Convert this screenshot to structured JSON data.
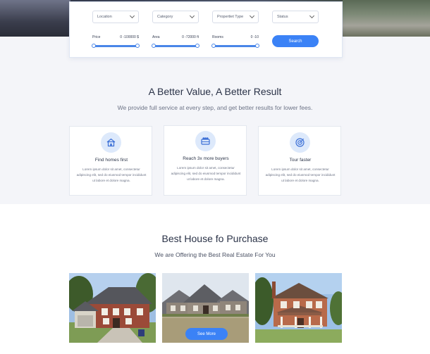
{
  "search": {
    "selects": [
      {
        "label": "Location"
      },
      {
        "label": "Category"
      },
      {
        "label": "Propertiet Type"
      },
      {
        "label": "Status"
      }
    ],
    "ranges": [
      {
        "label": "Price",
        "value": "0 -100000 $"
      },
      {
        "label": "Area",
        "value": "0 -72000 ft"
      },
      {
        "label": "Rooms",
        "value": "0 -10"
      }
    ],
    "button_label": "Search"
  },
  "value_section": {
    "title": "A Better Value, A Better Result",
    "subtitle": "We provide full service at every step, and get better results for lower fees.",
    "cards": [
      {
        "icon": "house-search-icon",
        "title": "Find homes first",
        "text": "Lorem ipsum dolor sit amet, consectetur adipiscing elit, sed do eiusmod tempor incididunt ut labore et dolore magna."
      },
      {
        "icon": "buyers-group-icon",
        "title": "Reach 3x more buyers",
        "text": "Lorem ipsum dolor sit amet, consectetur adipiscing elit, sed do eiusmod tempor incididunt ut labore et dolore magna."
      },
      {
        "icon": "target-icon",
        "title": "Tour faster",
        "text": "Lorem ipsum dolor sit amet, consectetur adipiscing elit, sed do eiusmod tempor incididunt ut labore et dolore magna."
      }
    ]
  },
  "purchase_section": {
    "title": "Best House fo Purchase",
    "subtitle": "We are Offering the Best Real Estate For You",
    "see_more_label": "See More"
  },
  "colors": {
    "accent": "#3b82f6",
    "icon_bg": "#dde9fb"
  }
}
